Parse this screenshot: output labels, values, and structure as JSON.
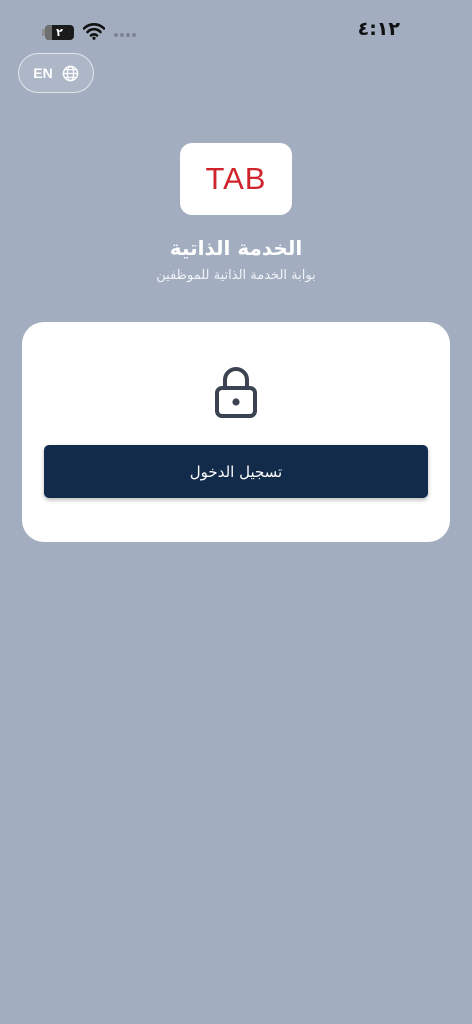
{
  "status_bar": {
    "time": "٤:١٢",
    "battery_level": "٢",
    "icons": [
      "wifi-icon",
      "cellular-signal-icon",
      "battery-icon"
    ]
  },
  "language_toggle": {
    "label": "EN",
    "icon": "globe-icon"
  },
  "branding": {
    "logo_text": "TAB",
    "logo_color": "#d0242d",
    "title": "الخدمة الذاتية",
    "subtitle": "بوابة الخدمة الذاتية للموظفين"
  },
  "login_card": {
    "icon": "lock-icon",
    "button_label": "تسجيل الدخول",
    "button_color": "#132b4b"
  },
  "colors": {
    "background": "#a2adc0",
    "card": "#ffffff"
  }
}
